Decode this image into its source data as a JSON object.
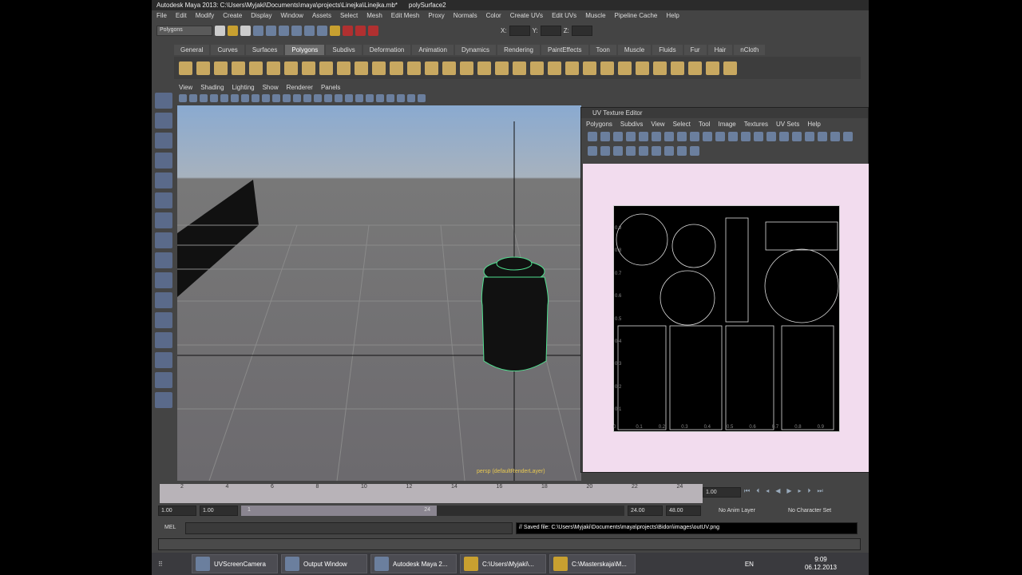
{
  "window": {
    "title": "Autodesk Maya 2013: C:\\Users\\Myjaki\\Documents\\maya\\projects\\Linejka\\Linejka.mb*",
    "object": "polySurface2"
  },
  "menu": [
    "File",
    "Edit",
    "Modify",
    "Create",
    "Display",
    "Window",
    "Assets",
    "Select",
    "Mesh",
    "Edit Mesh",
    "Proxy",
    "Normals",
    "Color",
    "Create UVs",
    "Edit UVs",
    "Muscle",
    "Pipeline Cache",
    "Help"
  ],
  "mode_select": "Polygons",
  "coords": {
    "x": "X:",
    "y": "Y:",
    "z": "Z:"
  },
  "shelf_tabs": [
    "General",
    "Curves",
    "Surfaces",
    "Polygons",
    "Subdivs",
    "Deformation",
    "Animation",
    "Dynamics",
    "Rendering",
    "PaintEffects",
    "Toon",
    "Muscle",
    "Fluids",
    "Fur",
    "Hair",
    "nCloth"
  ],
  "active_shelf_tab": "Polygons",
  "panel_menu": [
    "View",
    "Shading",
    "Lighting",
    "Show",
    "Renderer",
    "Panels"
  ],
  "viewport_label": "persp (defaultRenderLayer)",
  "uv_editor": {
    "title": "UV Texture Editor",
    "menu": [
      "Polygons",
      "Subdivs",
      "View",
      "Select",
      "Tool",
      "Image",
      "Textures",
      "UV Sets",
      "Help"
    ],
    "ticks_u": [
      "0",
      "0.1",
      "0.2",
      "0.3",
      "0.4",
      "0.5",
      "0.6",
      "0.7",
      "0.8",
      "0.9"
    ],
    "ticks_v": [
      "0.9",
      "0.8",
      "0.7",
      "0.6",
      "0.5",
      "0.4",
      "0.3",
      "0.2",
      "0.1"
    ]
  },
  "timeline": {
    "ticks": [
      "2",
      "4",
      "6",
      "8",
      "10",
      "12",
      "14",
      "16",
      "18",
      "20",
      "22",
      "24"
    ],
    "current": "1.00"
  },
  "range": {
    "start": "1.00",
    "playstart": "1.00",
    "slider_start": "1",
    "slider_end": "24",
    "playend": "24.00",
    "end": "48.00",
    "anim_layer": "No Anim Layer",
    "char_set": "No Character Set"
  },
  "command": {
    "label": "MEL",
    "feedback": "// Saved file: C:\\Users\\Myjaki\\Documents\\maya\\projects\\Bidon\\images\\outUV.png"
  },
  "taskbar": {
    "items": [
      "UVScreenCamera",
      "Output Window",
      "Autodesk Maya 2...",
      "C:\\Users\\Myjaki\\...",
      "C:\\Masterskaja\\M..."
    ],
    "lang": "EN",
    "time": "9:09",
    "date": "06.12.2013"
  }
}
